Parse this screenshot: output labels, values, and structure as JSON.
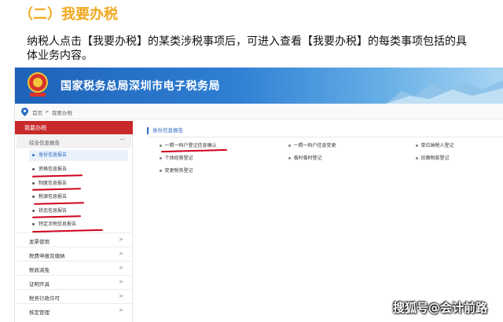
{
  "slide": {
    "heading": "（二）我要办税",
    "paragraph": "纳税人点击【我要办税】的某类涉税事项后，可进入查看【我要办税】的每类事项包括的具体业务内容。"
  },
  "portal": {
    "title": "国家税务总局深圳市电子税务局",
    "breadcrumb": [
      "首页",
      ">",
      "我要办税"
    ]
  },
  "sidebar": {
    "header": "我要办税",
    "group": "综合信息报告",
    "subitems": [
      "身份信息报告",
      "资格信息报告",
      "制度信息报告",
      "税源信息报告",
      "状态信息报告",
      "特定涉税信息报告"
    ],
    "menus": [
      "发票使用",
      "税费申报及缴纳",
      "税收减免",
      "证明开具",
      "税务行政许可",
      "核定管理"
    ]
  },
  "main": {
    "section_title": "身份信息报告",
    "items": [
      "一照一码户登记信息确认",
      "一照一码户信息变更",
      "单位纳税人登记",
      "个体经营登记",
      "临时临时登记",
      "扣缴税款登记",
      "变更税务登记"
    ]
  },
  "watermark": "搜狐号@会计前路",
  "colors": {
    "accent_red": "#c82a2a",
    "link_blue": "#2d6bc4",
    "heading_orange": "#f0a81e",
    "underline_red": "#d0021b"
  }
}
